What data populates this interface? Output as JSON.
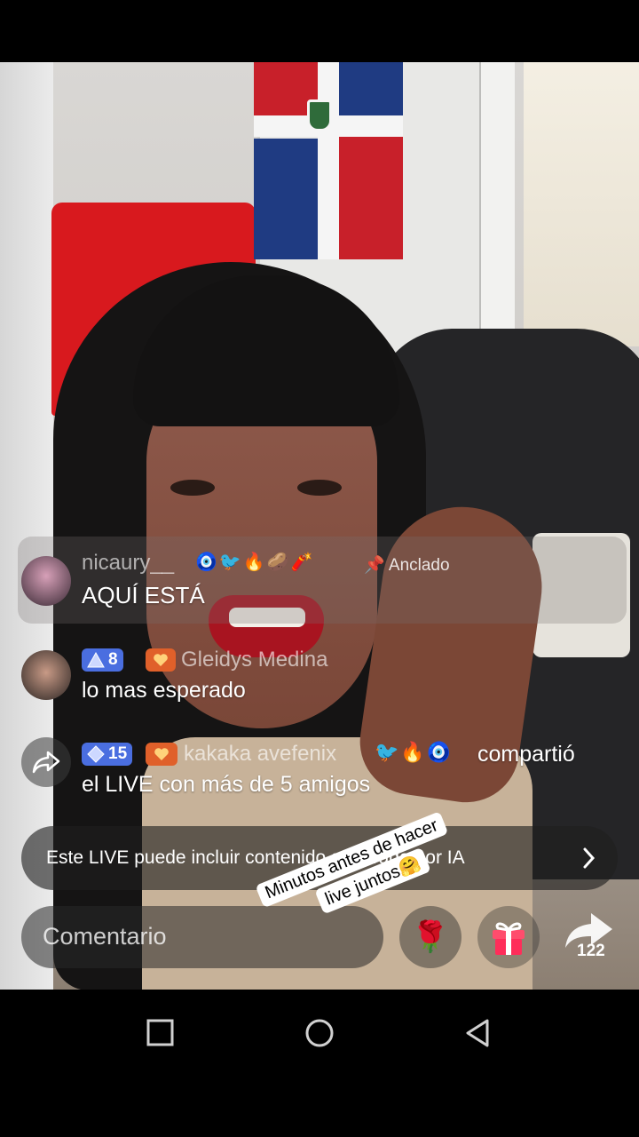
{
  "live": {
    "pinned_comment": {
      "username": "nicaury__",
      "emojis": "🧿🐦🔥🥔🧨",
      "pin_label": "Anclado",
      "message": "AQUÍ ESTÁ"
    },
    "comment2": {
      "level": "8",
      "fan_badge": "II",
      "username": "Gleidys Medina",
      "message": "lo mas esperado"
    },
    "comment3": {
      "level": "15",
      "fan_badge": "III",
      "username": "kakaka avefenix",
      "emojis": "🐦🔥🧿",
      "action": "compartió",
      "message": "el LIVE con más de 5 amigos"
    },
    "ai_notice": "Este LIVE puede incluir contenido generado por IA",
    "comment_placeholder": "Comentario",
    "rose_icon": "🌹",
    "share_count": "122",
    "sticker": {
      "line1": "Minutos antes de hacer",
      "line2": "live juntos🤗"
    }
  },
  "colors": {
    "level_badge": "#4a6ee0",
    "fan_badge": "#e0602a",
    "gift": "#ff2d5a"
  }
}
